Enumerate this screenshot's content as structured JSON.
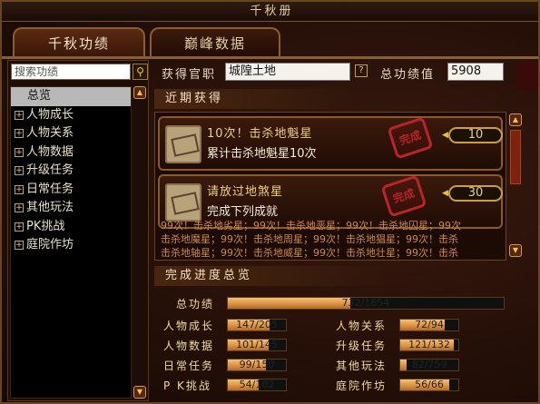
{
  "window": {
    "title": "千秋册"
  },
  "tabs": [
    {
      "label": "千秋功绩",
      "active": true
    },
    {
      "label": "巅峰数据",
      "active": false
    }
  ],
  "search": {
    "placeholder": "搜索功绩",
    "icon": "search-icon"
  },
  "tree": {
    "items": [
      {
        "label": "总览",
        "selected": true,
        "expandable": false
      },
      {
        "label": "人物成长",
        "selected": false,
        "expandable": true
      },
      {
        "label": "人物关系",
        "selected": false,
        "expandable": true
      },
      {
        "label": "人物数据",
        "selected": false,
        "expandable": true
      },
      {
        "label": "升级任务",
        "selected": false,
        "expandable": true
      },
      {
        "label": "日常任务",
        "selected": false,
        "expandable": true
      },
      {
        "label": "其他玩法",
        "selected": false,
        "expandable": true
      },
      {
        "label": "PK挑战",
        "selected": false,
        "expandable": true
      },
      {
        "label": "庭院作坊",
        "selected": false,
        "expandable": true
      }
    ]
  },
  "header": {
    "official_label": "获得官职",
    "official_value": "城隍土地",
    "help_icon_text": "?",
    "total_label": "总功绩值",
    "total_value": "5908"
  },
  "recent": {
    "title": "近期获得",
    "cards": [
      {
        "title": "10次！击杀地魁星",
        "desc": "累计击杀地魁星10次",
        "points": "10",
        "stamp": "完成"
      },
      {
        "title": "请放过地煞星",
        "desc": "完成下列成就",
        "points": "30",
        "stamp": "完成"
      }
    ],
    "sub_lines": [
      "99次！击杀地劣星；99次！击杀地恶星；99次！击杀地囚星；99次",
      "击杀地魔星；99次！击杀地周星；99次！击杀地猖星；99次！击杀",
      "击杀地轴星；99次！击杀地威星；99次！击杀地壮星；99次！击杀"
    ]
  },
  "progress": {
    "title": "完成进度总览",
    "total": {
      "label": "总功绩",
      "text": "732/1654",
      "fraction": 0.4426
    },
    "rows": [
      {
        "left": {
          "label": "人物成长",
          "text": "147/205",
          "fraction": 0.717
        },
        "right": {
          "label": "人物关系",
          "text": "72/94",
          "fraction": 0.766
        }
      },
      {
        "left": {
          "label": "人物数据",
          "text": "101/145",
          "fraction": 0.697
        },
        "right": {
          "label": "升级任务",
          "text": "121/132",
          "fraction": 0.917
        }
      },
      {
        "left": {
          "label": "日常任务",
          "text": "99/150",
          "fraction": 0.66
        },
        "right": {
          "label": "其他玩法",
          "text": "82/759",
          "fraction": 0.108
        }
      },
      {
        "left": {
          "label": "P K挑战",
          "text": "54/102",
          "fraction": 0.529
        },
        "right": {
          "label": "庭院作坊",
          "text": "56/66",
          "fraction": 0.848
        }
      }
    ]
  },
  "colors": {
    "accent": "#f2c24a",
    "bar_fill": "#e0a050",
    "stamp": "#b8242a",
    "selected_row": "#b8b8b8"
  }
}
